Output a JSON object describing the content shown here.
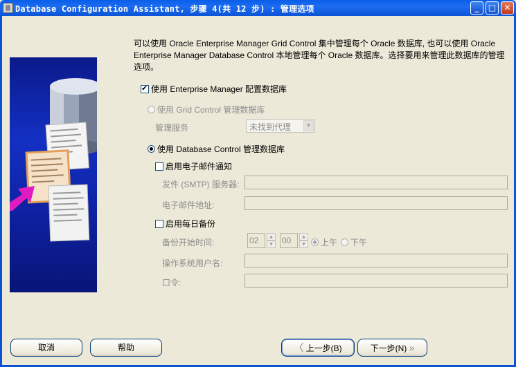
{
  "window": {
    "title": "Database Configuration Assistant, 步骤 4(共 12 步) : 管理选项",
    "minimize": "_",
    "maximize": "□",
    "close": "✕"
  },
  "intro_text": "可以使用 Oracle Enterprise Manager Grid Control 集中管理每个 Oracle 数据库, 也可以使用 Oracle Enterprise Manager Database Control 本地管理每个 Oracle 数据库。选择要用来管理此数据库的管理选项。",
  "em_config": {
    "label": "使用 Enterprise Manager 配置数据库",
    "checked": true
  },
  "grid_control": {
    "label": "使用 Grid Control 管理数据库",
    "mgmt_service_label": "管理服务",
    "mgmt_service_value": "未找到代理"
  },
  "db_control": {
    "label": "使用 Database Control 管理数据库",
    "email": {
      "label": "启用电子邮件通知",
      "smtp_label": "发件 (SMTP) 服务器:",
      "smtp_value": "",
      "address_label": "电子邮件地址:",
      "address_value": ""
    },
    "backup": {
      "label": "启用每日备份",
      "start_time_label": "备份开始时间:",
      "hour": "02",
      "minute": "00",
      "am_label": "上午",
      "pm_label": "下午",
      "os_user_label": "操作系统用户名:",
      "os_user_value": "",
      "password_label": "口令:",
      "password_value": ""
    }
  },
  "buttons": {
    "cancel": "取消",
    "help": "帮助",
    "back": "上一步(B)",
    "next": "下一步(N)"
  },
  "colors": {
    "titlebar": "#0b54d6",
    "dialog_bg": "#ece9d8",
    "disabled_text": "#8c8c8c"
  }
}
